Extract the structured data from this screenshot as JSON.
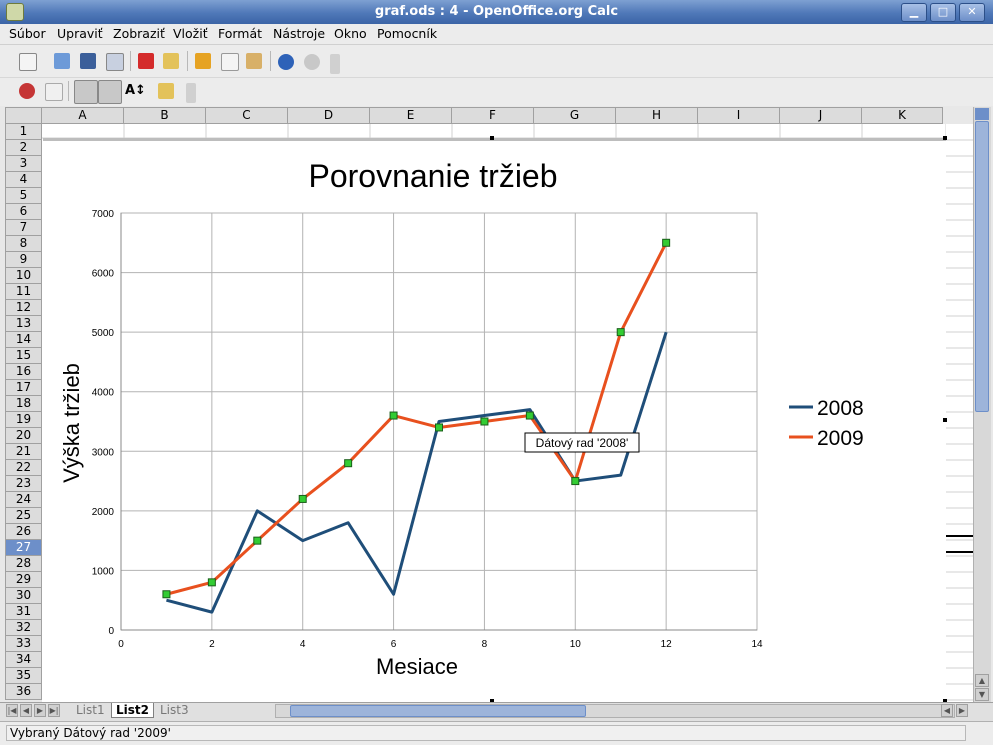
{
  "window": {
    "title": "graf.ods : 4 - OpenOffice.org Calc"
  },
  "menu": [
    "Súbor",
    "Upraviť",
    "Zobraziť",
    "Vložiť",
    "Formát",
    "Nástroje",
    "Okno",
    "Pomocník"
  ],
  "columns": [
    "A",
    "B",
    "C",
    "D",
    "E",
    "F",
    "G",
    "H",
    "I",
    "J",
    "K"
  ],
  "rows": [
    "1",
    "2",
    "3",
    "4",
    "5",
    "6",
    "7",
    "8",
    "9",
    "10",
    "11",
    "12",
    "13",
    "14",
    "15",
    "16",
    "17",
    "18",
    "19",
    "20",
    "21",
    "22",
    "23",
    "24",
    "25",
    "26",
    "27",
    "28",
    "29",
    "30",
    "31",
    "32",
    "33",
    "34",
    "35",
    "36"
  ],
  "selected_row": "27",
  "sheet_tabs": [
    "List1",
    "List2",
    "List3"
  ],
  "active_tab": "List2",
  "status": "Vybraný Dátový rad '2009'",
  "tooltip": "Dátový rad '2008'",
  "colors": {
    "s2008": "#1f4e79",
    "s2009": "#e8501e",
    "marker": "#33cc33"
  },
  "chart_data": {
    "type": "line",
    "title": "Porovnanie tržieb",
    "xlabel": "Mesiace",
    "ylabel": "Výška tržieb",
    "xlim": [
      0,
      14
    ],
    "ylim": [
      0,
      7000
    ],
    "xticks": [
      "0",
      "2",
      "4",
      "6",
      "8",
      "10",
      "12",
      "14"
    ],
    "yticks": [
      "0",
      "1000",
      "2000",
      "3000",
      "4000",
      "5000",
      "6000",
      "7000"
    ],
    "grid": true,
    "legend": "right",
    "series": [
      {
        "name": "2008",
        "x": [
          1,
          2,
          3,
          4,
          5,
          6,
          7,
          8,
          9,
          10,
          11,
          12
        ],
        "y": [
          500,
          300,
          2000,
          1500,
          1800,
          600,
          3500,
          3600,
          3700,
          2500,
          2600,
          5000
        ]
      },
      {
        "name": "2009",
        "x": [
          1,
          2,
          3,
          4,
          5,
          6,
          7,
          8,
          9,
          10,
          11,
          12
        ],
        "y": [
          600,
          800,
          1500,
          2200,
          2800,
          3600,
          3400,
          3500,
          3600,
          2500,
          5000,
          6500
        ]
      }
    ]
  }
}
